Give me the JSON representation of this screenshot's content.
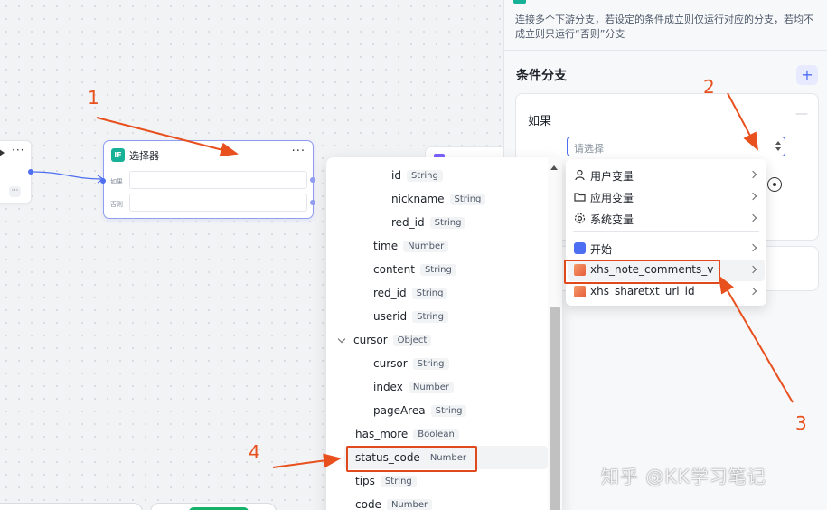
{
  "left_node": {
    "label_fragment": "t",
    "chip": "···"
  },
  "selector_node": {
    "badge": "IF",
    "title": "选择器",
    "if_label": "如果",
    "else_label": "否则"
  },
  "panel": {
    "description": "连接多个下游分支，若设定的条件成立则仅运行对应的分支，若均不成立则只运行“否则”分支",
    "section_title": "条件分支",
    "add_symbol": "+",
    "if_title": "如果",
    "collapse_symbol": "—",
    "select_placeholder": "请选择"
  },
  "source_menu": {
    "items": [
      {
        "label": "用户变量",
        "icon": "person-icon"
      },
      {
        "label": "应用变量",
        "icon": "folder-icon"
      },
      {
        "label": "系统变量",
        "icon": "gear-icon"
      },
      {
        "label": "开始",
        "icon": "start-node-icon"
      },
      {
        "label": "xhs_note_comments_v",
        "icon": "plugin-icon"
      },
      {
        "label": "xhs_sharetxt_url_id",
        "icon": "plugin-icon"
      }
    ]
  },
  "variable_list": {
    "rows": [
      {
        "name": "id",
        "type": "String",
        "indent": 3
      },
      {
        "name": "nickname",
        "type": "String",
        "indent": 3
      },
      {
        "name": "red_id",
        "type": "String",
        "indent": 3
      },
      {
        "name": "time",
        "type": "Number",
        "indent": 2
      },
      {
        "name": "content",
        "type": "String",
        "indent": 2
      },
      {
        "name": "red_id",
        "type": "String",
        "indent": 2
      },
      {
        "name": "userid",
        "type": "String",
        "indent": 2
      },
      {
        "name": "cursor",
        "type": "Object",
        "indent": 1,
        "expanded": true
      },
      {
        "name": "cursor",
        "type": "String",
        "indent": 2
      },
      {
        "name": "index",
        "type": "Number",
        "indent": 2
      },
      {
        "name": "pageArea",
        "type": "String",
        "indent": 2
      },
      {
        "name": "has_more",
        "type": "Boolean",
        "indent": 1
      },
      {
        "name": "status_code",
        "type": "Number",
        "indent": 1
      },
      {
        "name": "tips",
        "type": "String",
        "indent": 1
      },
      {
        "name": "code",
        "type": "Number",
        "indent": 1
      }
    ]
  },
  "annotations": {
    "n1": "1",
    "n2": "2",
    "n3": "3",
    "n4": "4",
    "color": "#e8501e"
  },
  "watermark": "知乎 @KK学习笔记",
  "colors": {
    "accent": "#4e6ef2",
    "if_badge": "#16b196",
    "annotation": "#e8501e"
  }
}
